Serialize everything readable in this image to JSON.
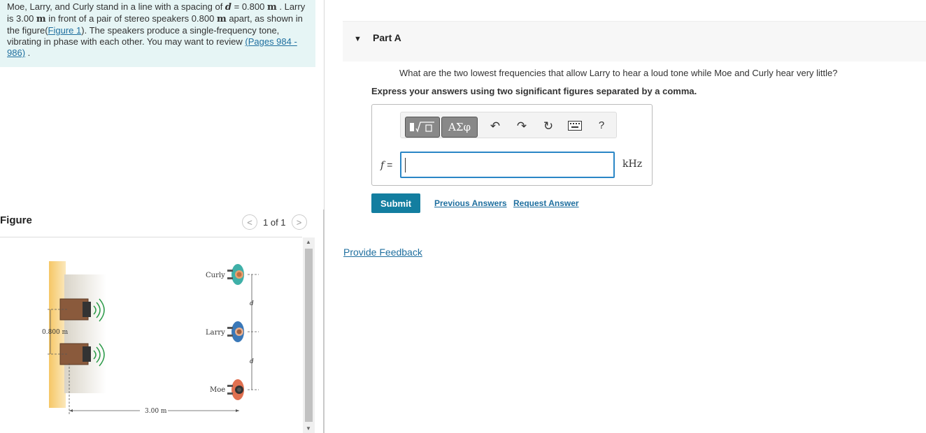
{
  "problem": {
    "p1": "Moe, Larry, and Curly stand in a line with a spacing of ",
    "var_d": "d",
    "p2": " = 0.800 ",
    "unit_m": "m",
    "p3": " . Larry is 3.00 ",
    "p4": " in front of a pair of stereo speakers 0.800 ",
    "p5": " apart, as shown in the figure(",
    "figure_link": "Figure 1",
    "p6": "). The speakers produce a single-frequency tone, vibrating in phase with each other. You may want to review ",
    "pages_link": "(Pages 984 - 986)",
    "p7": " ."
  },
  "figure_panel": {
    "title": "Figure",
    "page_text": "1 of 1",
    "prev_label": "<",
    "next_label": ">",
    "labels": {
      "curly": "Curly",
      "larry": "Larry",
      "moe": "Moe",
      "speaker_spacing": "0.800 m",
      "distance": "3.00 m",
      "d1": "d",
      "d2": "d"
    }
  },
  "part": {
    "title": "Part A",
    "question": "What are the two lowest frequencies that allow Larry to hear a loud tone while Moe and Curly hear very little?",
    "instruction": "Express your answers using two significant figures separated by a comma.",
    "variable": "f",
    "equals": "=",
    "unit": "kHz",
    "input_value": "",
    "toolbar": {
      "greek_label": "ΑΣφ",
      "help_label": "?"
    },
    "submit_label": "Submit",
    "previous_answers_label": "Previous Answers",
    "request_answer_label": "Request Answer"
  },
  "feedback_label": "Provide Feedback"
}
